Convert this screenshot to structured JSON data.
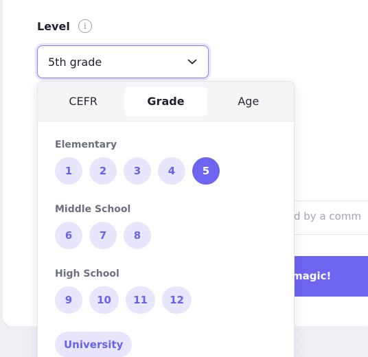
{
  "level": {
    "label": "Level",
    "info_icon": "info-icon",
    "selected_value": "5th grade"
  },
  "background": {
    "input_placeholder_fragment": "d by a comm",
    "button_label_fragment": "magic!"
  },
  "dropdown": {
    "tabs": [
      {
        "label": "CEFR",
        "active": false
      },
      {
        "label": "Grade",
        "active": true
      },
      {
        "label": "Age",
        "active": false
      }
    ],
    "sections": [
      {
        "title": "Elementary",
        "items": [
          "1",
          "2",
          "3",
          "4",
          "5"
        ]
      },
      {
        "title": "Middle School",
        "items": [
          "6",
          "7",
          "8"
        ]
      },
      {
        "title": "High School",
        "items": [
          "9",
          "10",
          "11",
          "12"
        ]
      }
    ],
    "extra_option": "University",
    "selected_item": "5"
  },
  "colors": {
    "accent": "#6e64f0",
    "chip_bg": "#e8e6fd",
    "chip_text": "#6c61ee"
  }
}
